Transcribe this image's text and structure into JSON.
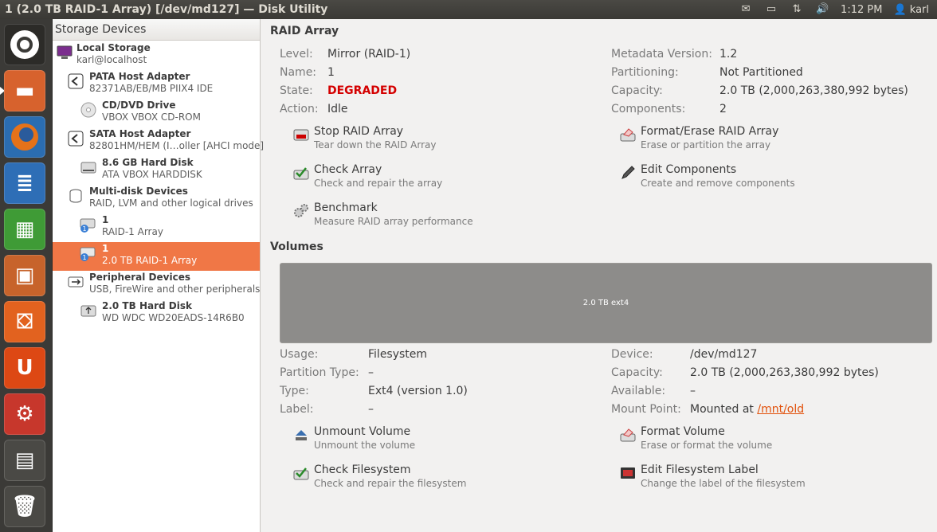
{
  "window": {
    "title": "1 (2.0 TB RAID-1 Array) [/dev/md127] — Disk Utility"
  },
  "tray": {
    "clock": "1:12 PM",
    "user": "karl"
  },
  "sidebar": {
    "header": "Storage Devices",
    "items": [
      {
        "title": "Local Storage",
        "subtitle": "karl@localhost"
      },
      {
        "title": "PATA Host Adapter",
        "subtitle": "82371AB/EB/MB PIIX4 IDE"
      },
      {
        "title": "CD/DVD Drive",
        "subtitle": "VBOX VBOX CD-ROM"
      },
      {
        "title": "SATA Host Adapter",
        "subtitle": "82801HM/HEM (I…oller [AHCI mode]"
      },
      {
        "title": "8.6 GB Hard Disk",
        "subtitle": "ATA VBOX HARDDISK"
      },
      {
        "title": "Multi-disk Devices",
        "subtitle": "RAID, LVM and other logical drives"
      },
      {
        "title": "1",
        "subtitle": "RAID-1 Array"
      },
      {
        "title": "1",
        "subtitle": "2.0 TB RAID-1 Array"
      },
      {
        "title": "Peripheral Devices",
        "subtitle": "USB, FireWire and other peripherals"
      },
      {
        "title": "2.0 TB Hard Disk",
        "subtitle": "WD WDC WD20EADS-14R6B0"
      }
    ]
  },
  "raid": {
    "section_title": "RAID Array",
    "left": [
      {
        "label": "Level:",
        "value": "Mirror (RAID-1)"
      },
      {
        "label": "Name:",
        "value": "1"
      },
      {
        "label": "State:",
        "value": "DEGRADED"
      },
      {
        "label": "Action:",
        "value": "Idle"
      }
    ],
    "right": [
      {
        "label": "Metadata Version:",
        "value": "1.2"
      },
      {
        "label": "Partitioning:",
        "value": "Not Partitioned"
      },
      {
        "label": "Capacity:",
        "value": "2.0 TB (2,000,263,380,992 bytes)"
      },
      {
        "label": "Components:",
        "value": "2"
      }
    ],
    "actions": [
      {
        "name": "Stop RAID Array",
        "desc": "Tear down the RAID Array"
      },
      {
        "name": "Format/Erase RAID Array",
        "desc": "Erase or partition the array"
      },
      {
        "name": "Check Array",
        "desc": "Check and repair the array"
      },
      {
        "name": "Edit Components",
        "desc": "Create and remove components"
      },
      {
        "name": "Benchmark",
        "desc": "Measure RAID array performance"
      }
    ]
  },
  "volumes": {
    "section_title": "Volumes",
    "bar_label": "2.0 TB ext4",
    "left": [
      {
        "label": "Usage:",
        "value": "Filesystem"
      },
      {
        "label": "Partition Type:",
        "value": "–"
      },
      {
        "label": "Type:",
        "value": "Ext4 (version 1.0)"
      },
      {
        "label": "Label:",
        "value": "–"
      }
    ],
    "right": [
      {
        "label": "Device:",
        "value": "/dev/md127"
      },
      {
        "label": "Capacity:",
        "value": "2.0 TB (2,000,263,380,992 bytes)"
      },
      {
        "label": "Available:",
        "value": "–"
      },
      {
        "label": "Mount Point:",
        "value": "Mounted at",
        "link": "/mnt/old"
      }
    ],
    "actions": [
      {
        "name": "Unmount Volume",
        "desc": "Unmount the volume"
      },
      {
        "name": "Format Volume",
        "desc": "Erase or format the volume"
      },
      {
        "name": "Check Filesystem",
        "desc": "Check and repair the filesystem"
      },
      {
        "name": "Edit Filesystem Label",
        "desc": "Change the label of the filesystem"
      }
    ]
  },
  "colors": {
    "selection": "#f07746",
    "degraded": "#d40000",
    "link": "#e2510b"
  }
}
